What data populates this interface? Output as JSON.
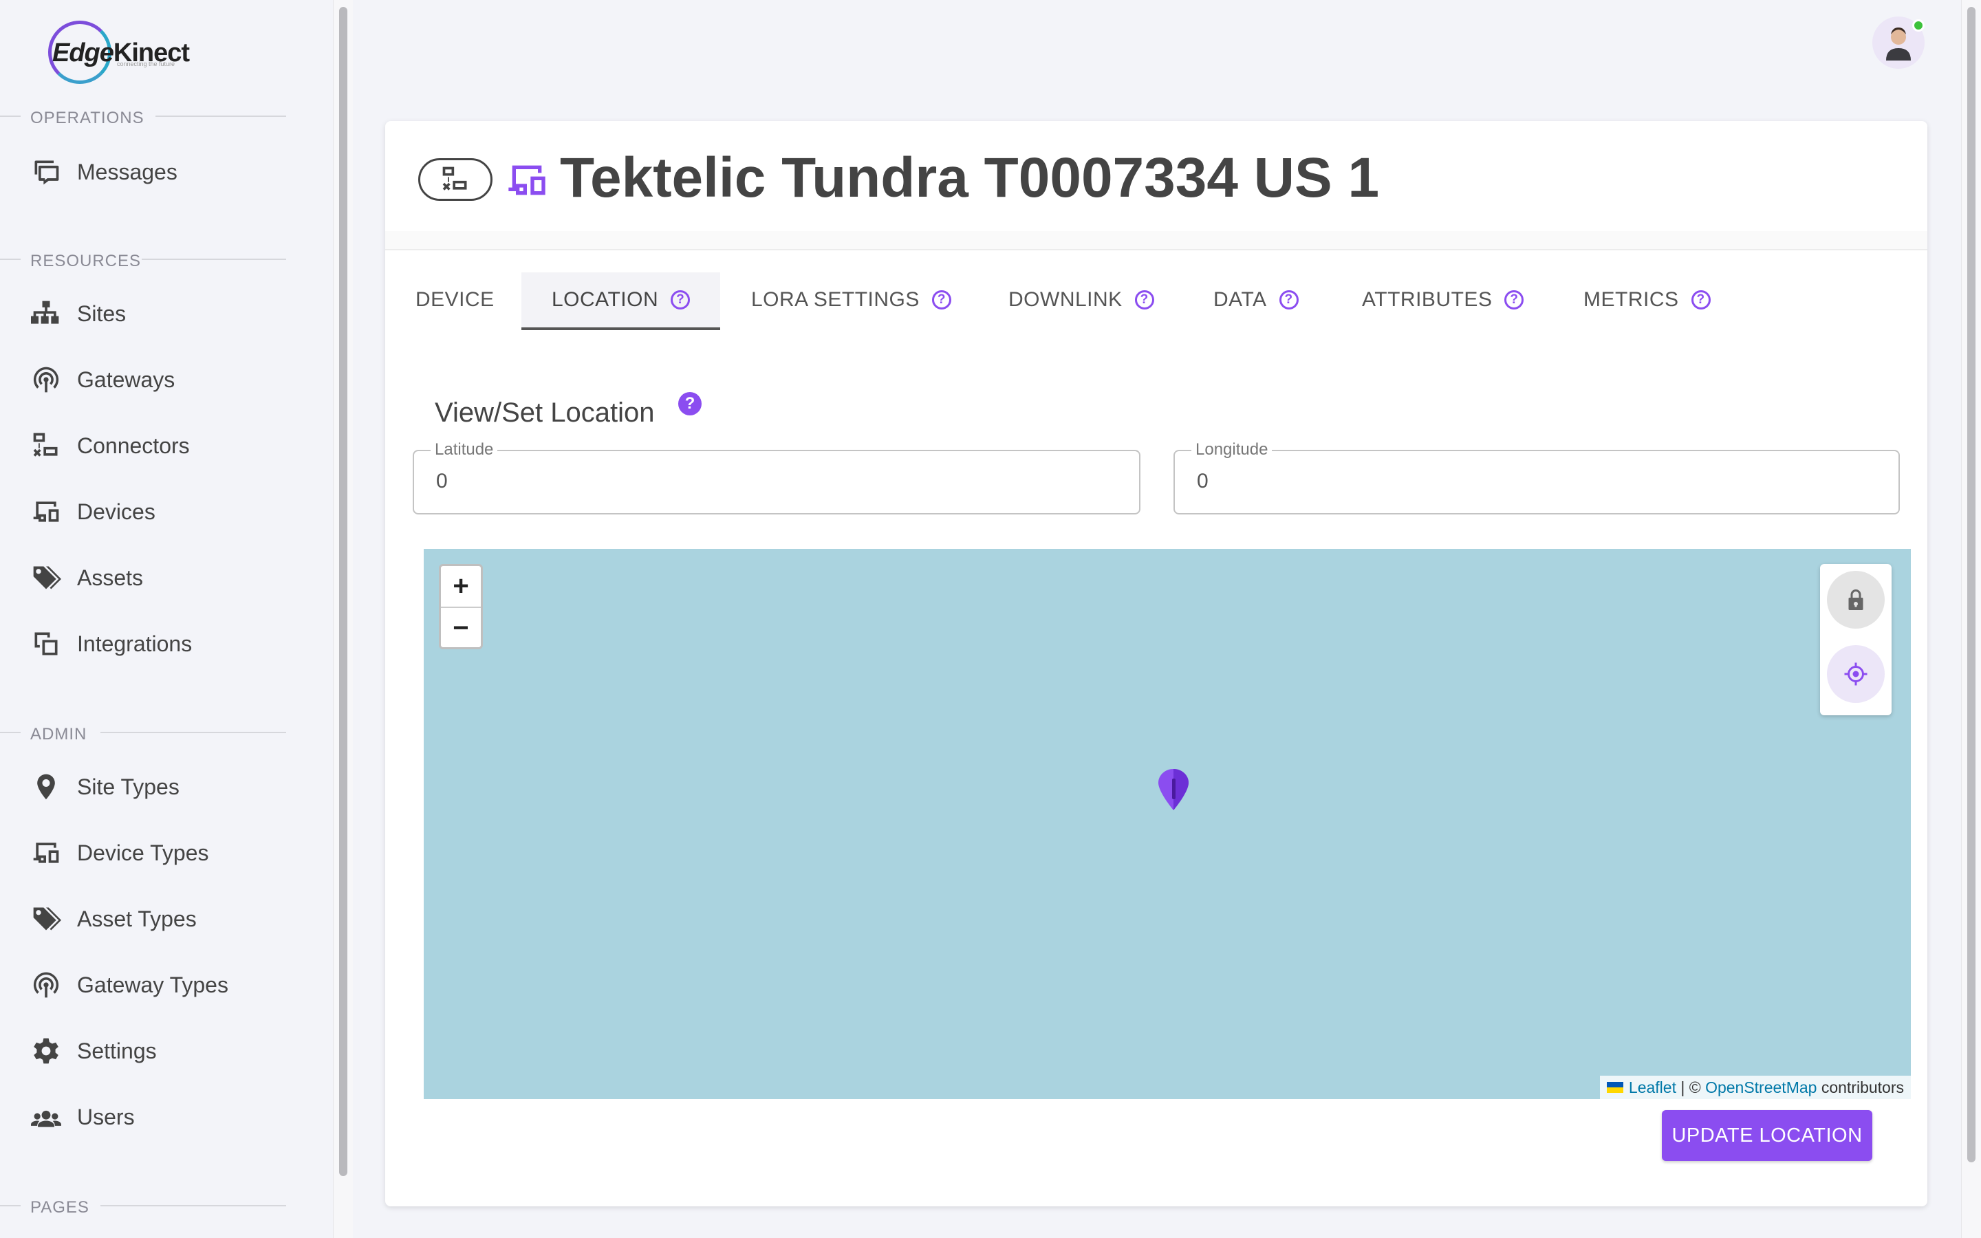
{
  "logo": {
    "main": "Edge",
    "accent": "Kinect",
    "tagline": "connecting the future"
  },
  "sidebar": {
    "sections": [
      {
        "label": "OPERATIONS",
        "items": [
          {
            "label": "Messages",
            "icon": "messages-icon"
          }
        ]
      },
      {
        "label": "RESOURCES",
        "items": [
          {
            "label": "Sites",
            "icon": "sitemap-icon"
          },
          {
            "label": "Gateways",
            "icon": "gateway-icon"
          },
          {
            "label": "Connectors",
            "icon": "connectors-icon"
          },
          {
            "label": "Devices",
            "icon": "devices-icon"
          },
          {
            "label": "Assets",
            "icon": "tags-icon"
          },
          {
            "label": "Integrations",
            "icon": "integrations-icon"
          }
        ]
      },
      {
        "label": "ADMIN",
        "items": [
          {
            "label": "Site Types",
            "icon": "location-pin-icon"
          },
          {
            "label": "Device Types",
            "icon": "devices-icon"
          },
          {
            "label": "Asset Types",
            "icon": "tags-icon"
          },
          {
            "label": "Gateway Types",
            "icon": "gateway-icon"
          },
          {
            "label": "Settings",
            "icon": "gear-icon"
          },
          {
            "label": "Users",
            "icon": "users-icon"
          }
        ]
      },
      {
        "label": "PAGES",
        "items": []
      }
    ]
  },
  "header": {
    "title": "Tektelic Tundra T0007334 US 1"
  },
  "tabs": [
    {
      "label": "DEVICE",
      "help": false
    },
    {
      "label": "LOCATION",
      "help": true,
      "active": true
    },
    {
      "label": "LORA SETTINGS",
      "help": true
    },
    {
      "label": "DOWNLINK",
      "help": true
    },
    {
      "label": "DATA",
      "help": true
    },
    {
      "label": "ATTRIBUTES",
      "help": true
    },
    {
      "label": "METRICS",
      "help": true
    }
  ],
  "location": {
    "section_title": "View/Set Location",
    "latitude": {
      "label": "Latitude",
      "value": "0"
    },
    "longitude": {
      "label": "Longitude",
      "value": "0"
    },
    "update_button": "UPDATE LOCATION"
  },
  "map": {
    "zoom_in": "+",
    "zoom_out": "−",
    "attribution": {
      "leaflet": "Leaflet",
      "sep": " | © ",
      "osm": "OpenStreetMap",
      "rest": " contributors"
    }
  },
  "help_glyph": "?",
  "colors": {
    "accent": "#8b4df0",
    "map_water": "#aad3df",
    "online": "#3cc13b"
  }
}
